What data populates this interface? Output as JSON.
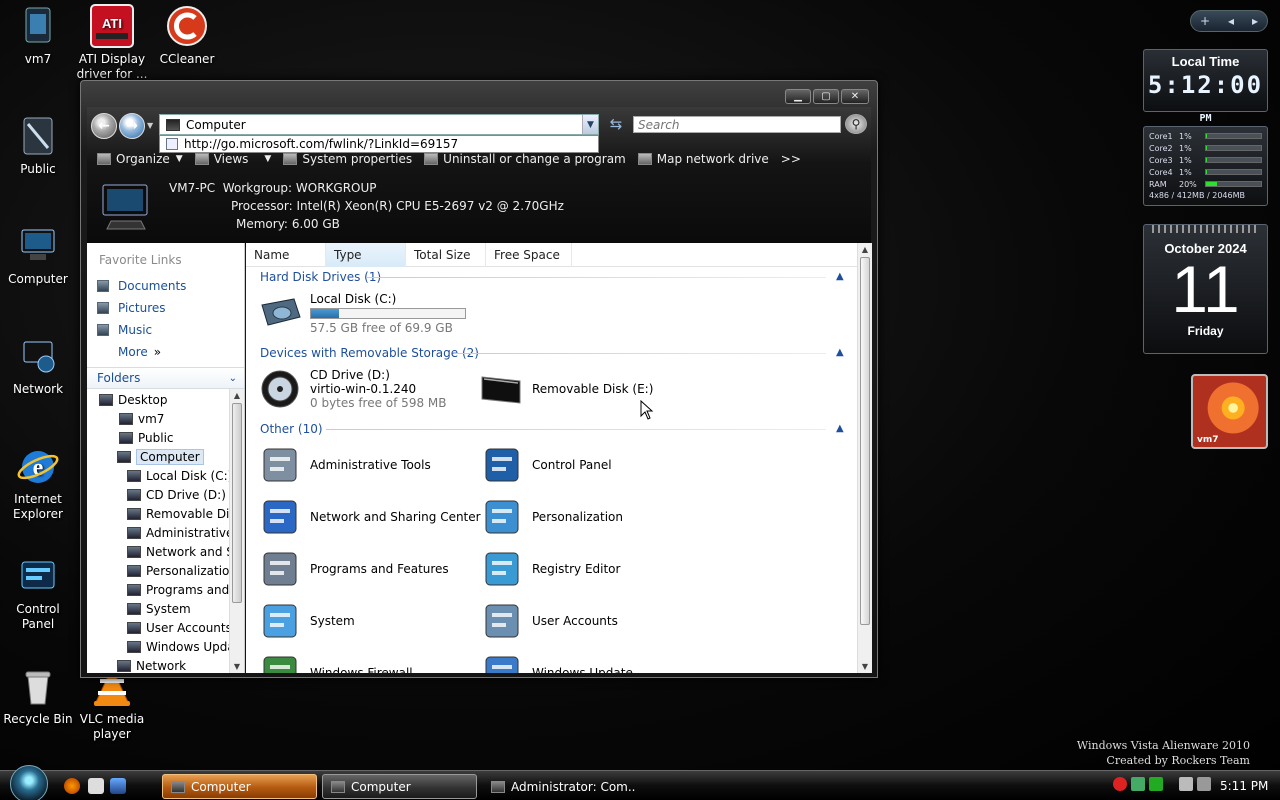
{
  "desktop": {
    "icons": [
      {
        "name": "vm7",
        "label": "vm7",
        "icon": "user-folder-icon"
      },
      {
        "name": "ati",
        "label": "ATI Display driver for ...",
        "icon": "ati-radeon-icon"
      },
      {
        "name": "ccleaner",
        "label": "CCleaner",
        "icon": "ccleaner-icon"
      },
      {
        "name": "public",
        "label": "Public",
        "icon": "public-folder-icon"
      },
      {
        "name": "computer",
        "label": "Computer",
        "icon": "computer-icon"
      },
      {
        "name": "network",
        "label": "Network",
        "icon": "network-icon"
      },
      {
        "name": "ie",
        "label": "Internet Explorer",
        "icon": "internet-explorer-icon"
      },
      {
        "name": "control-panel",
        "label": "Control Panel",
        "icon": "control-panel-icon"
      },
      {
        "name": "recycle-bin",
        "label": "Recycle Bin",
        "icon": "recycle-bin-icon"
      },
      {
        "name": "vlc",
        "label": "VLC media player",
        "icon": "vlc-icon"
      }
    ],
    "branding": [
      "Windows Vista Alienware 2010",
      "Created by Rockers Team"
    ]
  },
  "gadgets": {
    "toolbar": {
      "add": "+",
      "prev": "◂",
      "next": "▸"
    },
    "clock": {
      "title": "Local Time",
      "time": "5:12:00",
      "ampm": "PM"
    },
    "cpu": {
      "rows": [
        {
          "label": "Core1",
          "pct": "1%",
          "value": 0.01
        },
        {
          "label": "Core2",
          "pct": "1%",
          "value": 0.01
        },
        {
          "label": "Core3",
          "pct": "1%",
          "value": 0.01
        },
        {
          "label": "Core4",
          "pct": "1%",
          "value": 0.01
        },
        {
          "label": "RAM",
          "pct": "20%",
          "value": 0.2
        }
      ],
      "footer": "4x86 / 412MB / 2046MB"
    },
    "calendar": {
      "month_year": "October 2024",
      "day": "11",
      "weekday": "Friday"
    },
    "slideshow": {
      "caption": "vm7"
    }
  },
  "window": {
    "controls": {
      "minimize": "▁",
      "maximize": "▢",
      "close": "✕"
    },
    "address": {
      "value": "Computer",
      "suggestion": "http://go.microsoft.com/fwlink/?LinkId=69157"
    },
    "search": {
      "placeholder": "Search"
    },
    "toolbar": {
      "items": [
        {
          "label": "Organize",
          "has_menu": true
        },
        {
          "label": "Views",
          "has_menu": true
        },
        {
          "label": "System properties",
          "has_menu": false
        },
        {
          "label": "Uninstall or change a program",
          "has_menu": false
        },
        {
          "label": "Map network drive",
          "has_menu": false
        }
      ],
      "overflow": ">>"
    },
    "details": {
      "computer_name": "VM7-PC",
      "workgroup_label": "Workgroup:",
      "workgroup": "WORKGROUP",
      "processor_label": "Processor:",
      "processor": "Intel(R) Xeon(R) CPU E5-2697 v2 @ 2.70GHz",
      "memory_label": "Memory:",
      "memory": "6.00 GB"
    },
    "nav": {
      "favorites_title": "Favorite Links",
      "favorites": [
        "Documents",
        "Pictures",
        "Music"
      ],
      "more": "More",
      "folders_title": "Folders",
      "tree": [
        {
          "label": "Desktop",
          "level": 0
        },
        {
          "label": "vm7",
          "level": 1
        },
        {
          "label": "Public",
          "level": 1
        },
        {
          "label": "Computer",
          "level": 1,
          "selected": true
        },
        {
          "label": "Local Disk (C:)",
          "level": 2
        },
        {
          "label": "CD Drive (D:) v",
          "level": 2
        },
        {
          "label": "Removable Dis",
          "level": 2
        },
        {
          "label": "Administrative",
          "level": 2
        },
        {
          "label": "Network and S",
          "level": 2
        },
        {
          "label": "Personalizatio",
          "level": 2
        },
        {
          "label": "Programs and",
          "level": 2
        },
        {
          "label": "System",
          "level": 2
        },
        {
          "label": "User Accounts",
          "level": 2
        },
        {
          "label": "Windows Upda",
          "level": 2
        },
        {
          "label": "Network",
          "level": 1
        }
      ]
    },
    "content": {
      "columns": [
        "Name",
        "Type",
        "Total Size",
        "Free Space"
      ],
      "groups": [
        {
          "title": "Hard Disk Drives (1)"
        },
        {
          "title": "Devices with Removable Storage (2)"
        },
        {
          "title": "Other (10)"
        }
      ],
      "local_disk": {
        "name": "Local Disk (C:)",
        "free": "57.5 GB free of 69.9 GB",
        "used_fraction": 0.18
      },
      "cd_drive": {
        "name": "CD Drive (D:)",
        "label": "virtio-win-0.1.240",
        "free": "0 bytes free of 598 MB"
      },
      "removable": {
        "name": "Removable Disk (E:)"
      },
      "other": [
        "Administrative Tools",
        "Control Panel",
        "Network and Sharing Center",
        "Personalization",
        "Programs and Features",
        "Registry Editor",
        "System",
        "User Accounts",
        "Windows Firewall",
        "Windows Update"
      ]
    }
  },
  "taskbar": {
    "buttons": [
      {
        "label": "Computer",
        "active": true
      },
      {
        "label": "Computer",
        "active": false
      },
      {
        "label": "Administrator: Com...",
        "active": false
      }
    ],
    "time": "5:11 PM"
  }
}
